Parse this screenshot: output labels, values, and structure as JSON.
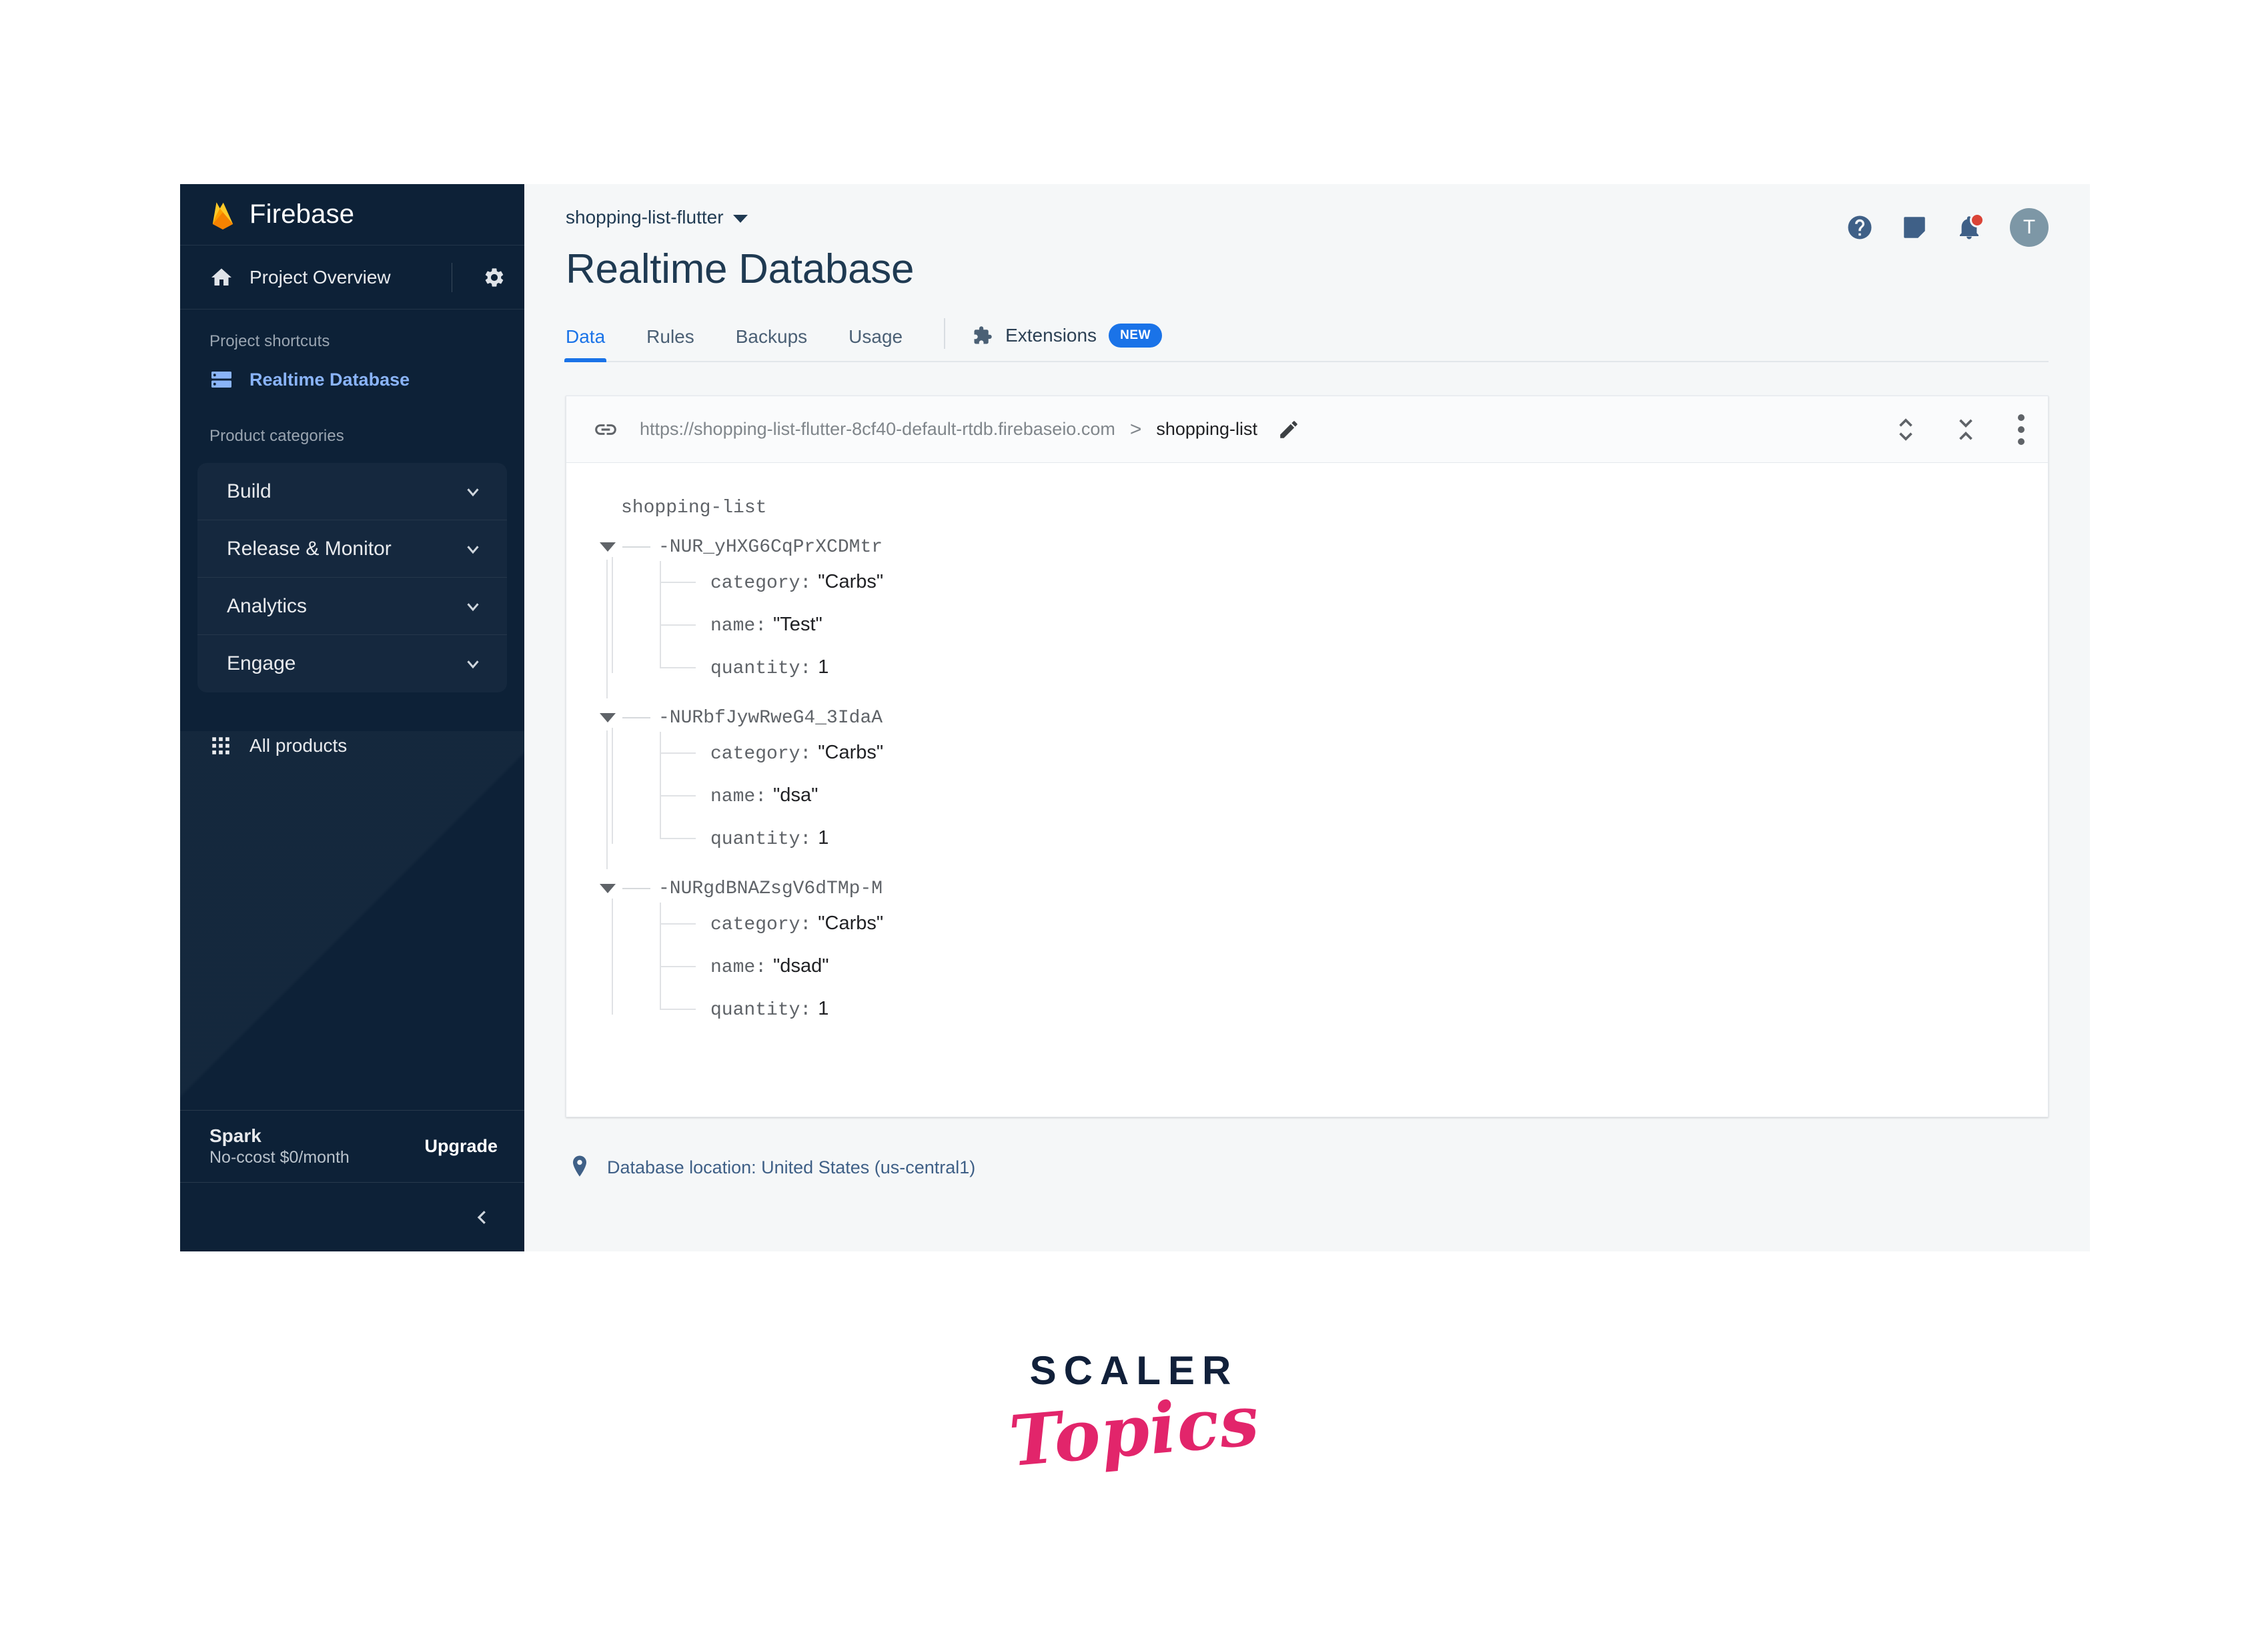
{
  "sidebar": {
    "brand": "Firebase",
    "project_overview": "Project Overview",
    "section_shortcuts": "Project shortcuts",
    "shortcut_item": "Realtime Database",
    "section_categories": "Product categories",
    "categories": [
      {
        "label": "Build"
      },
      {
        "label": "Release & Monitor"
      },
      {
        "label": "Analytics"
      },
      {
        "label": "Engage"
      }
    ],
    "all_products": "All products",
    "plan": {
      "name": "Spark",
      "cost": "No-ccost $0/month",
      "upgrade": "Upgrade"
    }
  },
  "header": {
    "project_selector": "shopping-list-flutter",
    "page_title": "Realtime Database",
    "tabs": [
      {
        "label": "Data",
        "active": true
      },
      {
        "label": "Rules",
        "active": false
      },
      {
        "label": "Backups",
        "active": false
      },
      {
        "label": "Usage",
        "active": false
      }
    ],
    "extensions": {
      "label": "Extensions",
      "badge": "NEW"
    },
    "avatar_initial": "T"
  },
  "panel": {
    "url": "https://shopping-list-flutter-8cf40-default-rtdb.firebaseio.com",
    "breadcrumb_separator": ">",
    "current_node": "shopping-list"
  },
  "tree": {
    "root": "shopping-list",
    "nodes": [
      {
        "key": "-NUR_yHXG6CqPrXCDMtr",
        "fields": [
          {
            "key": "category:",
            "value": "\"Carbs\""
          },
          {
            "key": "name:",
            "value": "\"Test\""
          },
          {
            "key": "quantity:",
            "value": "1"
          }
        ]
      },
      {
        "key": "-NURbfJywRweG4_3IdaA",
        "fields": [
          {
            "key": "category:",
            "value": "\"Carbs\""
          },
          {
            "key": "name:",
            "value": "\"dsa\""
          },
          {
            "key": "quantity:",
            "value": "1"
          }
        ]
      },
      {
        "key": "-NURgdBNAZsgV6dTMp-M",
        "fields": [
          {
            "key": "category:",
            "value": "\"Carbs\""
          },
          {
            "key": "name:",
            "value": "\"dsad\""
          },
          {
            "key": "quantity:",
            "value": "1"
          }
        ]
      }
    ]
  },
  "footer": {
    "database_location": "Database location: United States (us-central1)"
  },
  "watermark": {
    "line1": "SCALER",
    "line2": "Topics"
  },
  "colors": {
    "sidebar_bg": "#0d2137",
    "accent_blue": "#1a73e8",
    "link_blue": "#8ab4f8",
    "title_navy": "#1f3a52",
    "badge_red": "#db4437",
    "scaler_pink": "#e2256b"
  }
}
